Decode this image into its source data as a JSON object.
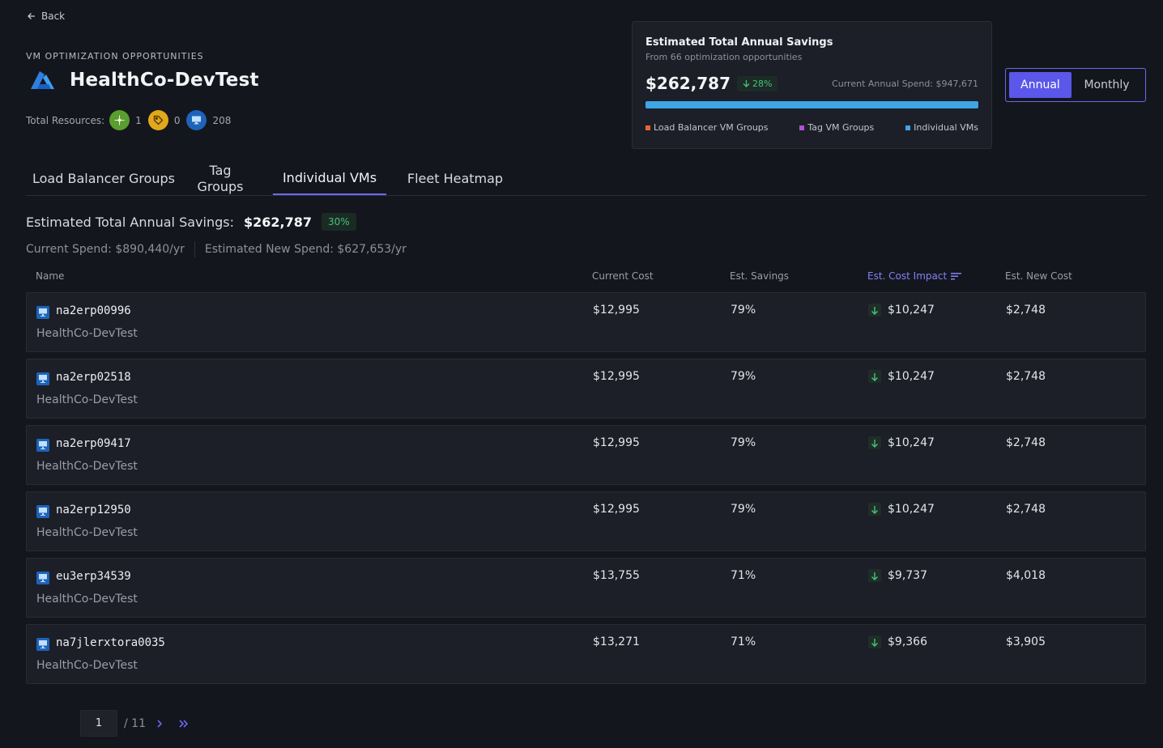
{
  "nav": {
    "back_label": "Back"
  },
  "header": {
    "section_label": "VM OPTIMIZATION OPPORTUNITIES",
    "title": "HealthCo-DevTest",
    "logo_icon": "azure-logo-icon",
    "resources_label": "Total Resources:",
    "resource_counts": [
      {
        "icon": "load-balancer-icon",
        "color": "#5a9e2f",
        "count": "1"
      },
      {
        "icon": "tag-icon",
        "color": "#e0a81a",
        "count": "0"
      },
      {
        "icon": "vm-icon",
        "color": "#1e63b8",
        "count": "208"
      }
    ]
  },
  "savings_card": {
    "title": "Estimated Total Annual Savings",
    "subtitle": "From 66 optimization opportunities",
    "value": "$262,787",
    "change": "28%",
    "current_spend": "Current Annual Spend: $947,671",
    "bar_color": "#3ea6e6",
    "legend": [
      {
        "label": "Load Balancer VM Groups",
        "color": "#e8672c"
      },
      {
        "label": "Tag VM Groups",
        "color": "#b34fd6"
      },
      {
        "label": "Individual VMs",
        "color": "#3ea6e6"
      }
    ]
  },
  "period_toggle": {
    "annual": "Annual",
    "monthly": "Monthly",
    "selected": "Annual"
  },
  "tabs": [
    {
      "label": "Load Balancer Groups"
    },
    {
      "label": "Tag\nGroups"
    },
    {
      "label": "Individual VMs",
      "active": true
    },
    {
      "label": "Fleet Heatmap"
    }
  ],
  "summary": {
    "label": "Estimated Total Annual Savings:",
    "value": "$262,787",
    "pct": "30%",
    "current_spend": "Current Spend: $890,440/yr",
    "new_spend": "Estimated New Spend: $627,653/yr"
  },
  "table": {
    "columns": {
      "name": "Name",
      "current_cost": "Current Cost",
      "est_savings": "Est. Savings",
      "est_cost_impact": "Est. Cost Impact",
      "est_new_cost": "Est. New Cost"
    },
    "rows": [
      {
        "name": "na2erp00996",
        "group": "HealthCo-DevTest",
        "current_cost": "$12,995",
        "savings": "79%",
        "impact": "$10,247",
        "new_cost": "$2,748"
      },
      {
        "name": "na2erp02518",
        "group": "HealthCo-DevTest",
        "current_cost": "$12,995",
        "savings": "79%",
        "impact": "$10,247",
        "new_cost": "$2,748"
      },
      {
        "name": "na2erp09417",
        "group": "HealthCo-DevTest",
        "current_cost": "$12,995",
        "savings": "79%",
        "impact": "$10,247",
        "new_cost": "$2,748"
      },
      {
        "name": "na2erp12950",
        "group": "HealthCo-DevTest",
        "current_cost": "$12,995",
        "savings": "79%",
        "impact": "$10,247",
        "new_cost": "$2,748"
      },
      {
        "name": "eu3erp34539",
        "group": "HealthCo-DevTest",
        "current_cost": "$13,755",
        "savings": "71%",
        "impact": "$9,737",
        "new_cost": "$4,018"
      },
      {
        "name": "na7jlerxtora0035",
        "group": "HealthCo-DevTest",
        "current_cost": "$13,271",
        "savings": "71%",
        "impact": "$9,366",
        "new_cost": "$3,905"
      }
    ]
  },
  "pagination": {
    "current_page": "1",
    "of_label": "/ 11"
  }
}
